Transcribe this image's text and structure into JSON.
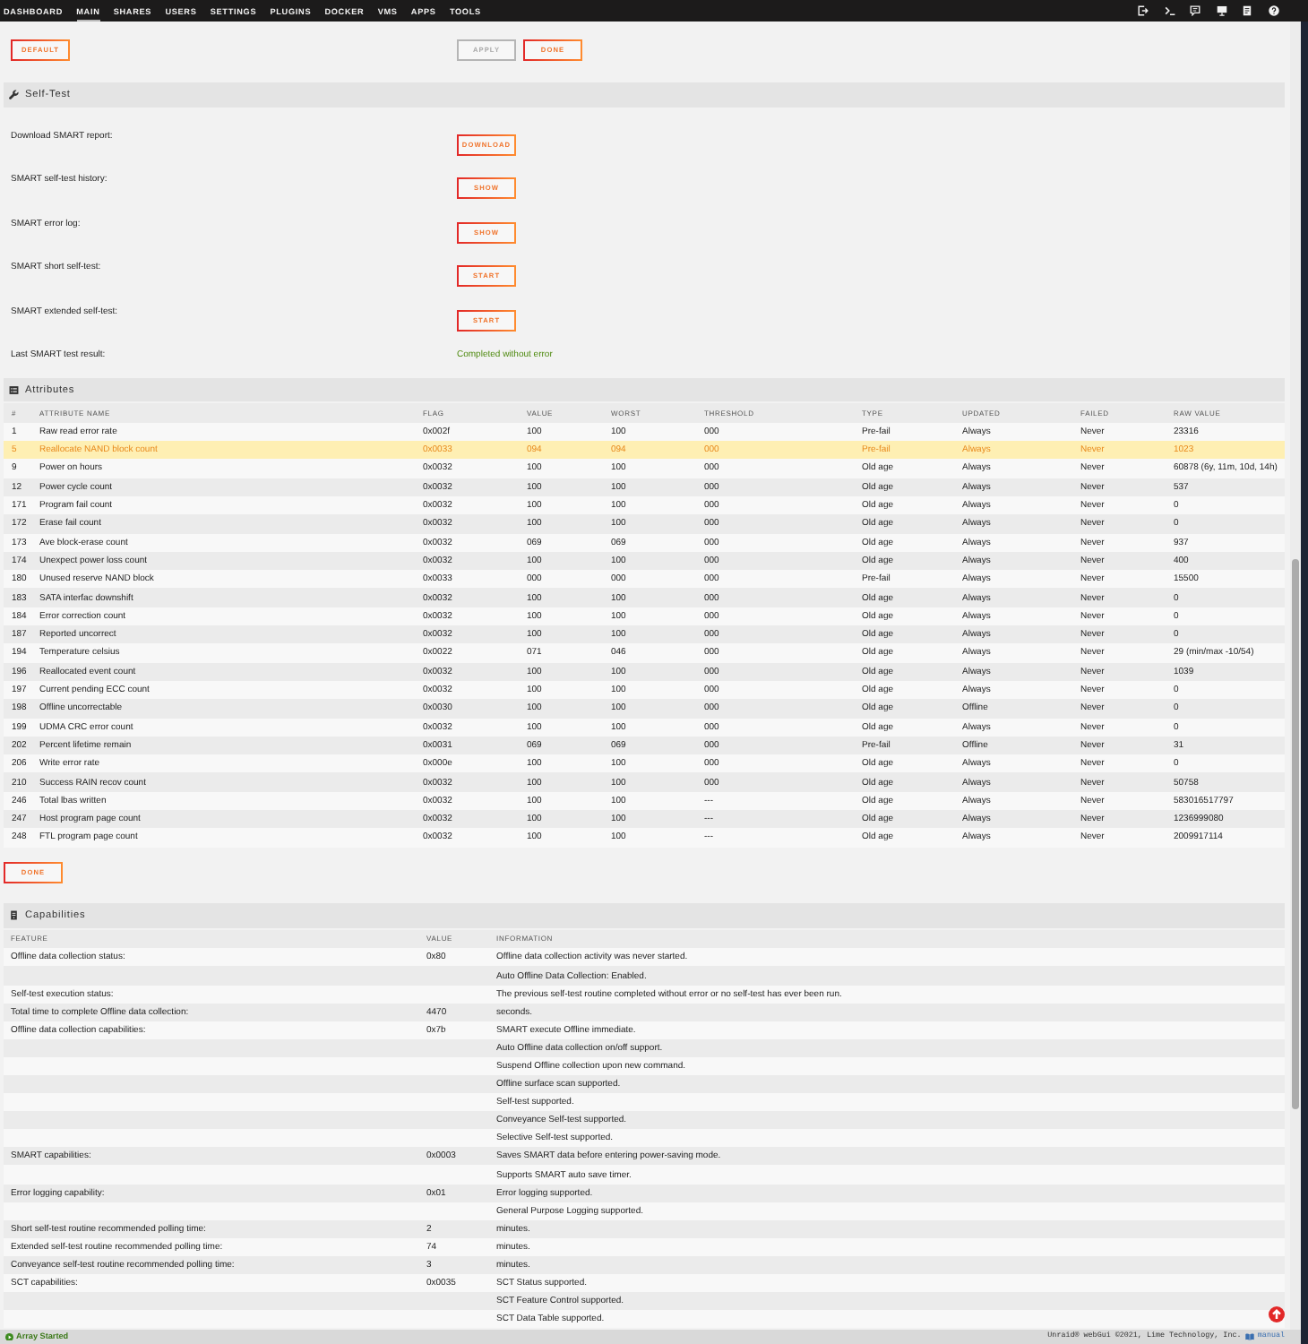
{
  "nav": {
    "items": [
      {
        "label": "DASHBOARD",
        "selected": false
      },
      {
        "label": "MAIN",
        "selected": true
      },
      {
        "label": "SHARES",
        "selected": false
      },
      {
        "label": "USERS",
        "selected": false
      },
      {
        "label": "SETTINGS",
        "selected": false
      },
      {
        "label": "PLUGINS",
        "selected": false
      },
      {
        "label": "DOCKER",
        "selected": false
      },
      {
        "label": "VMS",
        "selected": false
      },
      {
        "label": "APPS",
        "selected": false
      },
      {
        "label": "TOOLS",
        "selected": false
      }
    ]
  },
  "toolbar": {
    "left": [
      {
        "label": "DEFAULT",
        "disabled": false
      }
    ],
    "right": [
      {
        "label": "APPLY",
        "disabled": true
      },
      {
        "label": "DONE",
        "disabled": false
      }
    ]
  },
  "self_test": {
    "title": "Self-Test",
    "rows": [
      {
        "kind": "button",
        "label": "Download SMART report:",
        "button": "DOWNLOAD"
      },
      {
        "kind": "button",
        "label": "SMART self-test history:",
        "button": "SHOW"
      },
      {
        "kind": "button",
        "label": "SMART error log:",
        "button": "SHOW"
      },
      {
        "kind": "button",
        "label": "SMART short self-test:",
        "button": "START"
      },
      {
        "kind": "button",
        "label": "SMART extended self-test:",
        "button": "START"
      },
      {
        "kind": "result",
        "label": "Last SMART test result:",
        "value": "Completed without error"
      }
    ]
  },
  "attributes": {
    "title": "Attributes",
    "columns": [
      "#",
      "ATTRIBUTE NAME",
      "FLAG",
      "VALUE",
      "WORST",
      "THRESHOLD",
      "TYPE",
      "UPDATED",
      "FAILED",
      "RAW VALUE"
    ],
    "rows": [
      {
        "cells": [
          "1",
          "Raw read error rate",
          "0x002f",
          "100",
          "100",
          "000",
          "Pre-fail",
          "Always",
          "Never",
          "23316"
        ],
        "highlighted": false
      },
      {
        "cells": [
          "5",
          "Reallocate NAND block count",
          "0x0033",
          "094",
          "094",
          "000",
          "Pre-fail",
          "Always",
          "Never",
          "1023"
        ],
        "highlighted": true
      },
      {
        "cells": [
          "9",
          "Power on hours",
          "0x0032",
          "100",
          "100",
          "000",
          "Old age",
          "Always",
          "Never",
          "60878 (6y, 11m, 10d, 14h)"
        ],
        "highlighted": false
      },
      {
        "cells": [
          "12",
          "Power cycle count",
          "0x0032",
          "100",
          "100",
          "000",
          "Old age",
          "Always",
          "Never",
          "537"
        ],
        "highlighted": false
      },
      {
        "cells": [
          "171",
          "Program fail count",
          "0x0032",
          "100",
          "100",
          "000",
          "Old age",
          "Always",
          "Never",
          "0"
        ],
        "highlighted": false
      },
      {
        "cells": [
          "172",
          "Erase fail count",
          "0x0032",
          "100",
          "100",
          "000",
          "Old age",
          "Always",
          "Never",
          "0"
        ],
        "highlighted": false
      },
      {
        "cells": [
          "173",
          "Ave block-erase count",
          "0x0032",
          "069",
          "069",
          "000",
          "Old age",
          "Always",
          "Never",
          "937"
        ],
        "highlighted": false
      },
      {
        "cells": [
          "174",
          "Unexpect power loss count",
          "0x0032",
          "100",
          "100",
          "000",
          "Old age",
          "Always",
          "Never",
          "400"
        ],
        "highlighted": false
      },
      {
        "cells": [
          "180",
          "Unused reserve NAND block",
          "0x0033",
          "000",
          "000",
          "000",
          "Pre-fail",
          "Always",
          "Never",
          "15500"
        ],
        "highlighted": false
      },
      {
        "cells": [
          "183",
          "SATA interfac downshift",
          "0x0032",
          "100",
          "100",
          "000",
          "Old age",
          "Always",
          "Never",
          "0"
        ],
        "highlighted": false
      },
      {
        "cells": [
          "184",
          "Error correction count",
          "0x0032",
          "100",
          "100",
          "000",
          "Old age",
          "Always",
          "Never",
          "0"
        ],
        "highlighted": false
      },
      {
        "cells": [
          "187",
          "Reported uncorrect",
          "0x0032",
          "100",
          "100",
          "000",
          "Old age",
          "Always",
          "Never",
          "0"
        ],
        "highlighted": false
      },
      {
        "cells": [
          "194",
          "Temperature celsius",
          "0x0022",
          "071",
          "046",
          "000",
          "Old age",
          "Always",
          "Never",
          "29 (min/max -10/54)"
        ],
        "highlighted": false
      },
      {
        "cells": [
          "196",
          "Reallocated event count",
          "0x0032",
          "100",
          "100",
          "000",
          "Old age",
          "Always",
          "Never",
          "1039"
        ],
        "highlighted": false
      },
      {
        "cells": [
          "197",
          "Current pending ECC count",
          "0x0032",
          "100",
          "100",
          "000",
          "Old age",
          "Always",
          "Never",
          "0"
        ],
        "highlighted": false
      },
      {
        "cells": [
          "198",
          "Offline uncorrectable",
          "0x0030",
          "100",
          "100",
          "000",
          "Old age",
          "Offline",
          "Never",
          "0"
        ],
        "highlighted": false
      },
      {
        "cells": [
          "199",
          "UDMA CRC error count",
          "0x0032",
          "100",
          "100",
          "000",
          "Old age",
          "Always",
          "Never",
          "0"
        ],
        "highlighted": false
      },
      {
        "cells": [
          "202",
          "Percent lifetime remain",
          "0x0031",
          "069",
          "069",
          "000",
          "Pre-fail",
          "Offline",
          "Never",
          "31"
        ],
        "highlighted": false
      },
      {
        "cells": [
          "206",
          "Write error rate",
          "0x000e",
          "100",
          "100",
          "000",
          "Old age",
          "Always",
          "Never",
          "0"
        ],
        "highlighted": false
      },
      {
        "cells": [
          "210",
          "Success RAIN recov count",
          "0x0032",
          "100",
          "100",
          "000",
          "Old age",
          "Always",
          "Never",
          "50758"
        ],
        "highlighted": false
      },
      {
        "cells": [
          "246",
          "Total lbas written",
          "0x0032",
          "100",
          "100",
          "---",
          "Old age",
          "Always",
          "Never",
          "583016517797"
        ],
        "highlighted": false
      },
      {
        "cells": [
          "247",
          "Host program page count",
          "0x0032",
          "100",
          "100",
          "---",
          "Old age",
          "Always",
          "Never",
          "1236999080"
        ],
        "highlighted": false
      },
      {
        "cells": [
          "248",
          "FTL program page count",
          "0x0032",
          "100",
          "100",
          "---",
          "Old age",
          "Always",
          "Never",
          "2009917114"
        ],
        "highlighted": false
      }
    ]
  },
  "done_button": "DONE",
  "capabilities": {
    "title": "Capabilities",
    "columns": [
      "FEATURE",
      "VALUE",
      "INFORMATION"
    ],
    "rows": [
      {
        "feature": "Offline data collection status:",
        "value": "0x80",
        "information": "Offline data collection activity was never started."
      },
      {
        "information": "Auto Offline Data Collection: Enabled."
      },
      {
        "feature": "Self-test execution status:",
        "information": "The previous self-test routine completed without error or no self-test has ever been run."
      },
      {
        "feature": "Total time to complete Offline data collection:",
        "value": "4470",
        "information": "seconds."
      },
      {
        "feature": "Offline data collection capabilities:",
        "value": "0x7b",
        "information": "SMART execute Offline immediate."
      },
      {
        "information": "Auto Offline data collection on/off support."
      },
      {
        "information": "Suspend Offline collection upon new command."
      },
      {
        "information": "Offline surface scan supported."
      },
      {
        "information": "Self-test supported."
      },
      {
        "information": "Conveyance Self-test supported."
      },
      {
        "information": "Selective Self-test supported."
      },
      {
        "feature": "SMART capabilities:",
        "value": "0x0003",
        "information": "Saves SMART data before entering power-saving mode."
      },
      {
        "information": "Supports SMART auto save timer."
      },
      {
        "feature": "Error logging capability:",
        "value": "0x01",
        "information": "Error logging supported."
      },
      {
        "information": "General Purpose Logging supported."
      },
      {
        "feature": "Short self-test routine recommended polling time:",
        "value": "2",
        "information": "minutes."
      },
      {
        "feature": "Extended self-test routine recommended polling time:",
        "value": "74",
        "information": "minutes."
      },
      {
        "feature": "Conveyance self-test routine recommended polling time:",
        "value": "3",
        "information": "minutes."
      },
      {
        "feature": "SCT capabilities:",
        "value": "0x0035",
        "information": "SCT Status supported."
      },
      {
        "information": "SCT Feature Control supported."
      },
      {
        "information": "SCT Data Table supported."
      }
    ]
  },
  "status_bar": {
    "status": "Array Started",
    "copyright": "Unraid® webGui ©2021, Lime Technology, Inc.",
    "manual_link": "manual"
  }
}
